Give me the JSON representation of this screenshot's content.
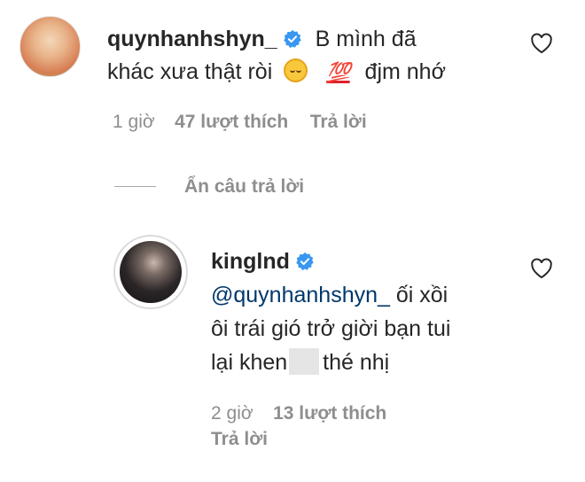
{
  "comment1": {
    "username": "quynhanhshyn_",
    "text_line1": "B mình đã",
    "text_line2_pre": "khác xưa thật ròi",
    "emoji_hundred": "💯",
    "text_line2_post": "đjm nhớ",
    "time": "1 giờ",
    "likes": "47 lượt thích",
    "reply_label": "Trả lời"
  },
  "hide_replies_label": "Ẩn câu trả lời",
  "reply1": {
    "username": "kinglnd",
    "mention": "@quynhanhshyn_",
    "text_line1_rest": " ối xồi",
    "text_line2": "ôi trái gió trở giời bạn tui",
    "text_line3_pre": "lại khen",
    "text_line3_post": "thé nhị",
    "time": "2 giờ",
    "likes": "13 lượt thích",
    "reply_label": "Trả lời"
  },
  "colors": {
    "verified": "#3897f0",
    "mention": "#00376b",
    "meta": "#8e8e8e"
  },
  "icons": [
    "verified-badge-icon",
    "heart-outline-icon"
  ]
}
